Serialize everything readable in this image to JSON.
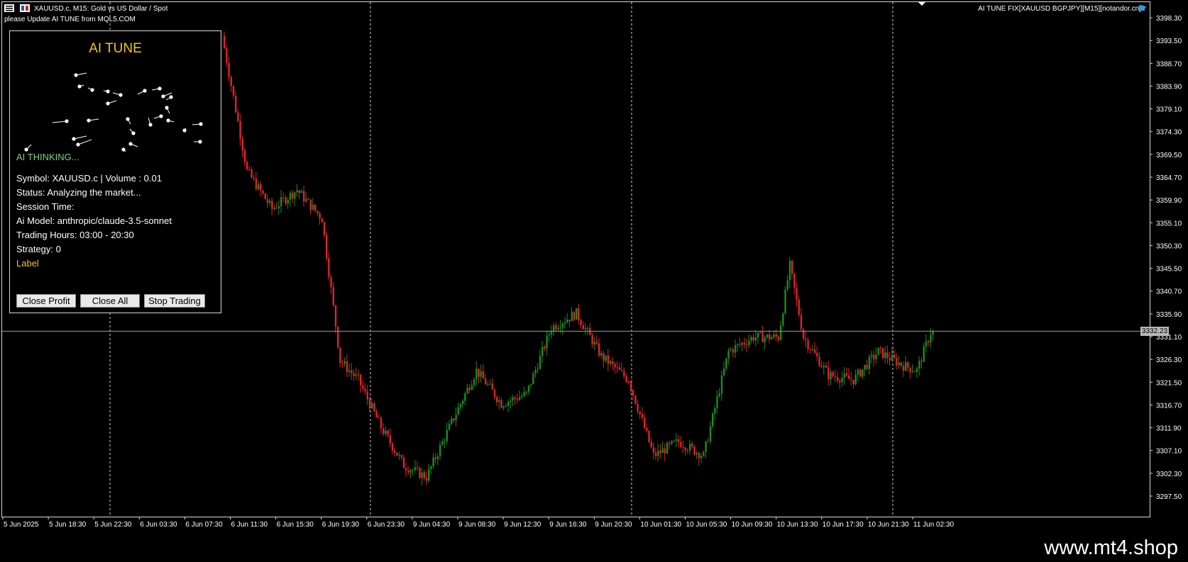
{
  "header": {
    "title": "XAUUSD.c, M15:  Gold vs US Dollar / Spot",
    "warning": "please Update AI TUNE from MQL5.COM",
    "indicator": "AI TUNE FIX[XAUUSD BGPJPY][M15][notandor.cn]"
  },
  "panel": {
    "title": "AI TUNE",
    "thinking": "AI THINKING...",
    "lines": [
      "Symbol: XAUUSD.c | Volume : 0.01",
      "Status: Analyzing the market...",
      "Session Time:",
      "Ai Model: anthropic/claude-3.5-sonnet",
      "Trading Hours: 03:00 - 20:30",
      "Strategy: 0"
    ],
    "label": "Label",
    "buttons": {
      "close_profit": "Close Profit",
      "close_all": "Close All",
      "stop_trading": "Stop Trading"
    }
  },
  "current_price": "3332.23",
  "footer": "www.mt4.shop",
  "colors": {
    "bull": "#1e8c1e",
    "bear": "#e0242a",
    "accent": "#f0c419",
    "thinking": "#7ed37e"
  },
  "chart_data": {
    "type": "candlestick",
    "y_ticks": [
      "3398.30",
      "3393.50",
      "3388.70",
      "3383.90",
      "3379.10",
      "3374.30",
      "3369.50",
      "3364.70",
      "3359.90",
      "3355.10",
      "3350.30",
      "3345.50",
      "3340.70",
      "3335.90",
      "3331.10",
      "3326.30",
      "3321.50",
      "3316.70",
      "3311.90",
      "3307.10",
      "3302.30",
      "3297.50"
    ],
    "x_ticks": [
      "5 Jun 2025",
      "5 Jun 18:30",
      "5 Jun 22:30",
      "6 Jun 03:30",
      "6 Jun 07:30",
      "6 Jun 11:30",
      "6 Jun 15:30",
      "6 Jun 19:30",
      "6 Jun 23:30",
      "9 Jun 04:30",
      "9 Jun 08:30",
      "9 Jun 12:30",
      "9 Jun 16:30",
      "9 Jun 20:30",
      "10 Jun 01:30",
      "10 Jun 05:30",
      "10 Jun 09:30",
      "10 Jun 13:30",
      "10 Jun 17:30",
      "10 Jun 21:30",
      "11 Jun 02:30"
    ],
    "ylim": [
      3294.5,
      3399.9
    ],
    "current_price": 3332.23,
    "visible_path": [
      [
        0,
        3394.5
      ],
      [
        11,
        3366
      ],
      [
        22,
        3358
      ],
      [
        33,
        3362
      ],
      [
        44,
        3356
      ],
      [
        52,
        3326
      ],
      [
        60,
        3322
      ],
      [
        70,
        3312
      ],
      [
        80,
        3304
      ],
      [
        90,
        3301.5
      ],
      [
        101,
        3313
      ],
      [
        112,
        3324
      ],
      [
        123,
        3317
      ],
      [
        134,
        3319
      ],
      [
        145,
        3333
      ],
      [
        156,
        3336
      ],
      [
        167,
        3327
      ],
      [
        179,
        3322
      ],
      [
        190,
        3306
      ],
      [
        201,
        3309
      ],
      [
        212,
        3306
      ],
      [
        223,
        3328
      ],
      [
        234,
        3331
      ],
      [
        245,
        3331
      ],
      [
        250,
        3346
      ],
      [
        256,
        3331
      ],
      [
        267,
        3323
      ],
      [
        278,
        3322
      ],
      [
        289,
        3328
      ],
      [
        300,
        3325
      ],
      [
        306,
        3324
      ],
      [
        312,
        3332
      ]
    ],
    "visible_from_bar": 100,
    "dashed_x": [
      155,
      522,
      890,
      1258
    ]
  }
}
